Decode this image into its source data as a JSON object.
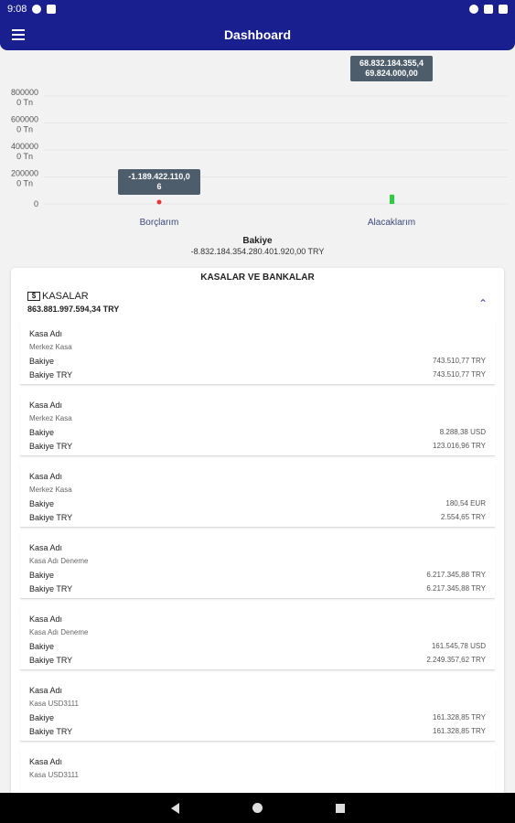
{
  "status_bar": {
    "time": "9:08"
  },
  "app_bar": {
    "title": "Dashboard"
  },
  "chart_data": {
    "type": "bar",
    "categories": [
      "Borçlarım",
      "Alacaklarım"
    ],
    "values": [
      -1189422110.06,
      68832184355.4
    ],
    "ylim": [
      0,
      800000000000
    ],
    "ytick_labels": [
      {
        "value": 800000000000,
        "line1": "800000",
        "line2": "0 Tn"
      },
      {
        "value": 600000000000,
        "line1": "600000",
        "line2": "0 Tn"
      },
      {
        "value": 400000000000,
        "line1": "400000",
        "line2": "0 Tn"
      },
      {
        "value": 200000000000,
        "line1": "200000",
        "line2": "0 Tn"
      },
      {
        "value": 0,
        "line1": "0",
        "line2": ""
      }
    ],
    "colors": [
      "#e53935",
      "#2ecc40"
    ],
    "tooltips": [
      {
        "line1": "-1.189.422.110,0",
        "line2": "6"
      },
      {
        "line1": "68.832.184.355,4",
        "line2": "69.824.000,00"
      }
    ]
  },
  "balance": {
    "title": "Bakiye",
    "value": "-8.832.184.354.280.401.920,00 TRY"
  },
  "card": {
    "title": "KASALAR VE BANKALAR",
    "section": {
      "label": "KASALAR",
      "icon": "cash-icon",
      "total": "863.881.997.594,34 TRY"
    },
    "items": [
      {
        "name_label": "Kasa Adı",
        "name": "Merkez Kasa",
        "bal_label": "Bakiye",
        "bal": "743.510,77 TRY",
        "try_label": "Bakiye TRY",
        "try": "743.510,77 TRY"
      },
      {
        "name_label": "Kasa Adı",
        "name": "Merkez Kasa",
        "bal_label": "Bakiye",
        "bal": "8.288,38 USD",
        "try_label": "Bakiye TRY",
        "try": "123.016,96 TRY"
      },
      {
        "name_label": "Kasa Adı",
        "name": "Merkez Kasa",
        "bal_label": "Bakiye",
        "bal": "180,54  EUR",
        "try_label": "Bakiye TRY",
        "try": "2.554,65 TRY"
      },
      {
        "name_label": "Kasa Adı",
        "name": "Kasa Adı Deneme",
        "bal_label": "Bakiye",
        "bal": "6.217.345,88 TRY",
        "try_label": "Bakiye TRY",
        "try": "6.217.345,88 TRY"
      },
      {
        "name_label": "Kasa Adı",
        "name": "Kasa Adı Deneme",
        "bal_label": "Bakiye",
        "bal": "161.545,78 USD",
        "try_label": "Bakiye TRY",
        "try": "2.249.357,62 TRY"
      },
      {
        "name_label": "Kasa Adı",
        "name": "Kasa USD3111",
        "bal_label": "Bakiye",
        "bal": "161.328,85 TRY",
        "try_label": "Bakiye TRY",
        "try": "161.328,85 TRY"
      },
      {
        "name_label": "Kasa Adı",
        "name": "Kasa USD3111",
        "bal_label": "",
        "bal": "",
        "try_label": "",
        "try": ""
      }
    ]
  }
}
